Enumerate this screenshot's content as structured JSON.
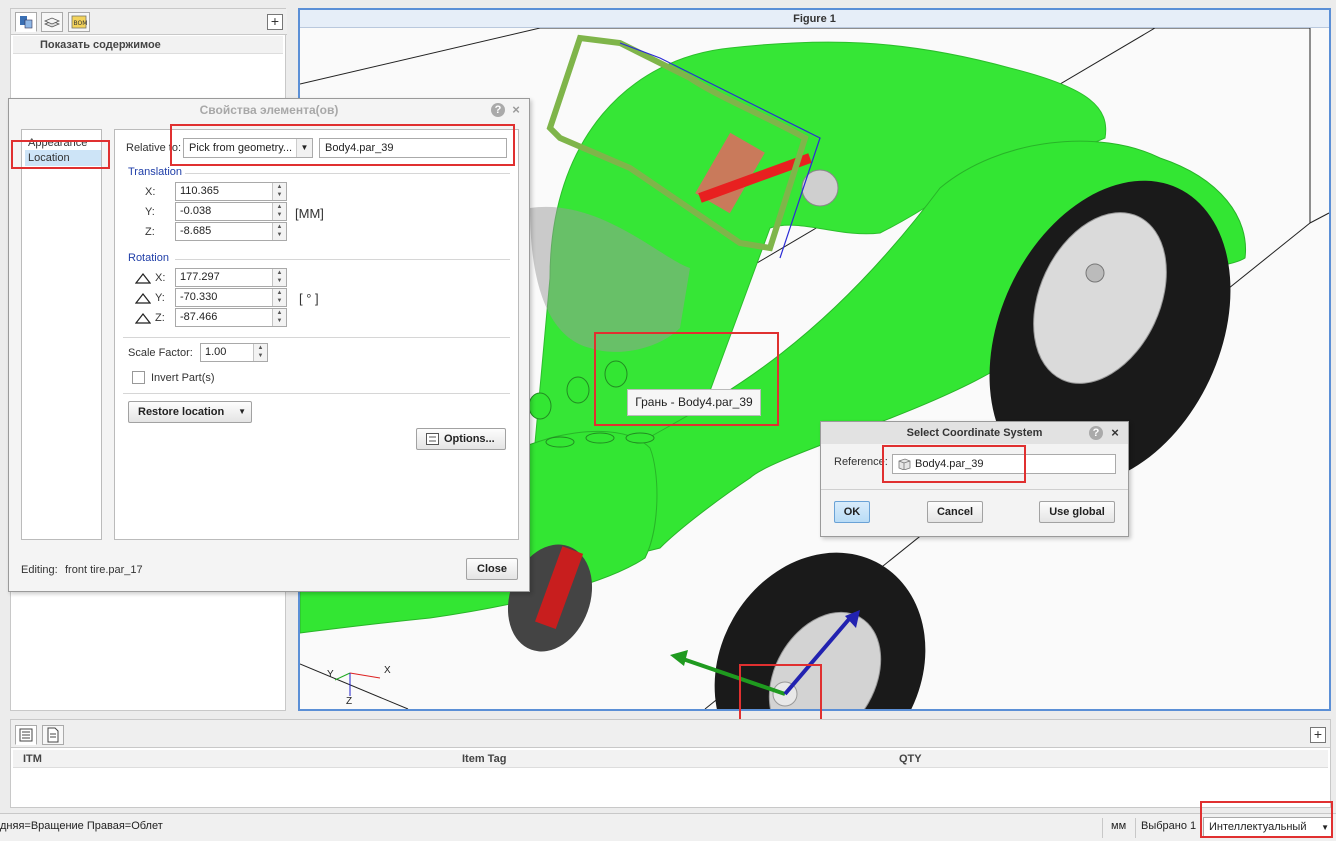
{
  "tree": {
    "header": "Показать содержимое",
    "tab_icons": [
      "model-tree-icon",
      "layers-icon",
      "bom-icon"
    ]
  },
  "graphics": {
    "title": "Figure 1",
    "triad": {
      "x": "X",
      "y": "Y",
      "z": "Z"
    }
  },
  "props_dialog": {
    "title": "Свойства элемента(ов)",
    "nav": [
      "Appearance",
      "Location"
    ],
    "selected_nav": "Location",
    "relative_to_label": "Relative to:",
    "relative_to_value": "Pick from geometry...",
    "reference_field": "Body4.par_39",
    "translation_section": "Translation",
    "translation": [
      {
        "axis": "X:",
        "value": "110.365"
      },
      {
        "axis": "Y:",
        "value": "-0.038"
      },
      {
        "axis": "Z:",
        "value": "-8.685"
      }
    ],
    "translation_unit": "[MM]",
    "rotation_section": "Rotation",
    "rotation": [
      {
        "axis": "X:",
        "value": "177.297"
      },
      {
        "axis": "Y:",
        "value": "-70.330"
      },
      {
        "axis": "Z:",
        "value": "-87.466"
      }
    ],
    "rotation_unit": "[ ° ]",
    "scale_label": "Scale Factor:",
    "scale_value": "1.00",
    "invert_label": "Invert Part(s)",
    "restore_label": "Restore location",
    "options_label": "Options...",
    "editing_label": "Editing:",
    "editing_value": "front tire.par_17",
    "close_label": "Close"
  },
  "tooltip": "Грань - Body4.par_39",
  "select_cs": {
    "title": "Select Coordinate System",
    "reference_label": "Reference:",
    "reference_value": "Body4.par_39",
    "ok": "OK",
    "cancel": "Cancel",
    "use_global": "Use global"
  },
  "bom": {
    "columns": [
      "ITM",
      "Item Tag",
      "QTY"
    ]
  },
  "status": {
    "hint": "дняя=Вращение  Правая=Облет",
    "units": "мм",
    "selected": "Выбрано 1",
    "filter": "Интеллектуальный"
  },
  "colors": {
    "body": "#33e633",
    "highlight": "#e03030",
    "frame": "#5b8fd6"
  }
}
